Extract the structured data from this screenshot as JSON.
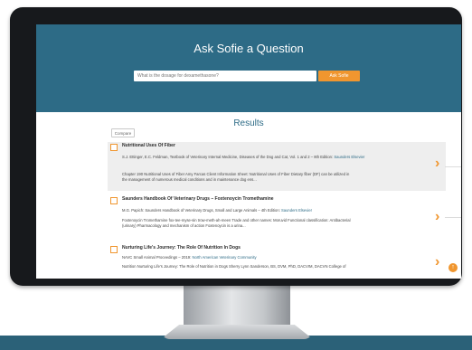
{
  "header": {
    "title": "Ask Sofie a Question",
    "search_placeholder": "What is the dosage for dexamethasone?",
    "ask_button_label": "Ask Sofie"
  },
  "results": {
    "heading": "Results",
    "compare_label": "Compare",
    "items": [
      {
        "title": "Nutritional Uses Of Fiber",
        "source": "S.J. Ettinger, E.C. Feldman, Textbook of Veterinary Internal Medicine, Diseases of the Dog and Cat, Vol. 1 and 2 – 8th Edition: ",
        "source_link": "Saunders Elsevier",
        "snippet_1": "Chapter 190 Nutritional Uses of Fiber Amy Farcas Client Information Sheet: Nutritional Uses of Fiber Dietary fiber (DF) can be utilized in",
        "snippet_2": "the management of numerous medical conditions and in maintenance dog ens..."
      },
      {
        "title": "Saunders Handbook Of Veterinary Drugs – Foxtenoycin Tromethamine",
        "source": "M.G. Papich: Saunders Handbook of Veterinary Drugs, Small and Large Animals – 4th Edition: ",
        "source_link": "Saunders Elsevier",
        "snippet_1": "Foxtenoycin Tromethamine fox-tee-myse-sin trow-meth-ah-meen Trade and other names: Moruvid Functional classification: Antibacterial",
        "snippet_2": "(urinary) Pharmacology and mechanism of action Foxtenoycin is a urina..."
      },
      {
        "title": "Nurturing Life's Journey: The Role Of Nutrition In Dogs",
        "source": "NAVC Small Animal Proceedings – 2019: ",
        "source_link": "North American Veterinary Community",
        "snippet_1": "Nutrition Nurturing Life's Journey: The Role of Nutrition in Dogs Sherry Lynn Sanderson, BS, DVM, PhD, DACVIM, DACVN College of"
      }
    ]
  },
  "icons": {
    "chevron": "chevron-right-icon",
    "scroll_top": "arrow-up-icon"
  },
  "colors": {
    "header": "#2d6b86",
    "accent": "#f0962f",
    "floor_band": "#2b6178"
  }
}
